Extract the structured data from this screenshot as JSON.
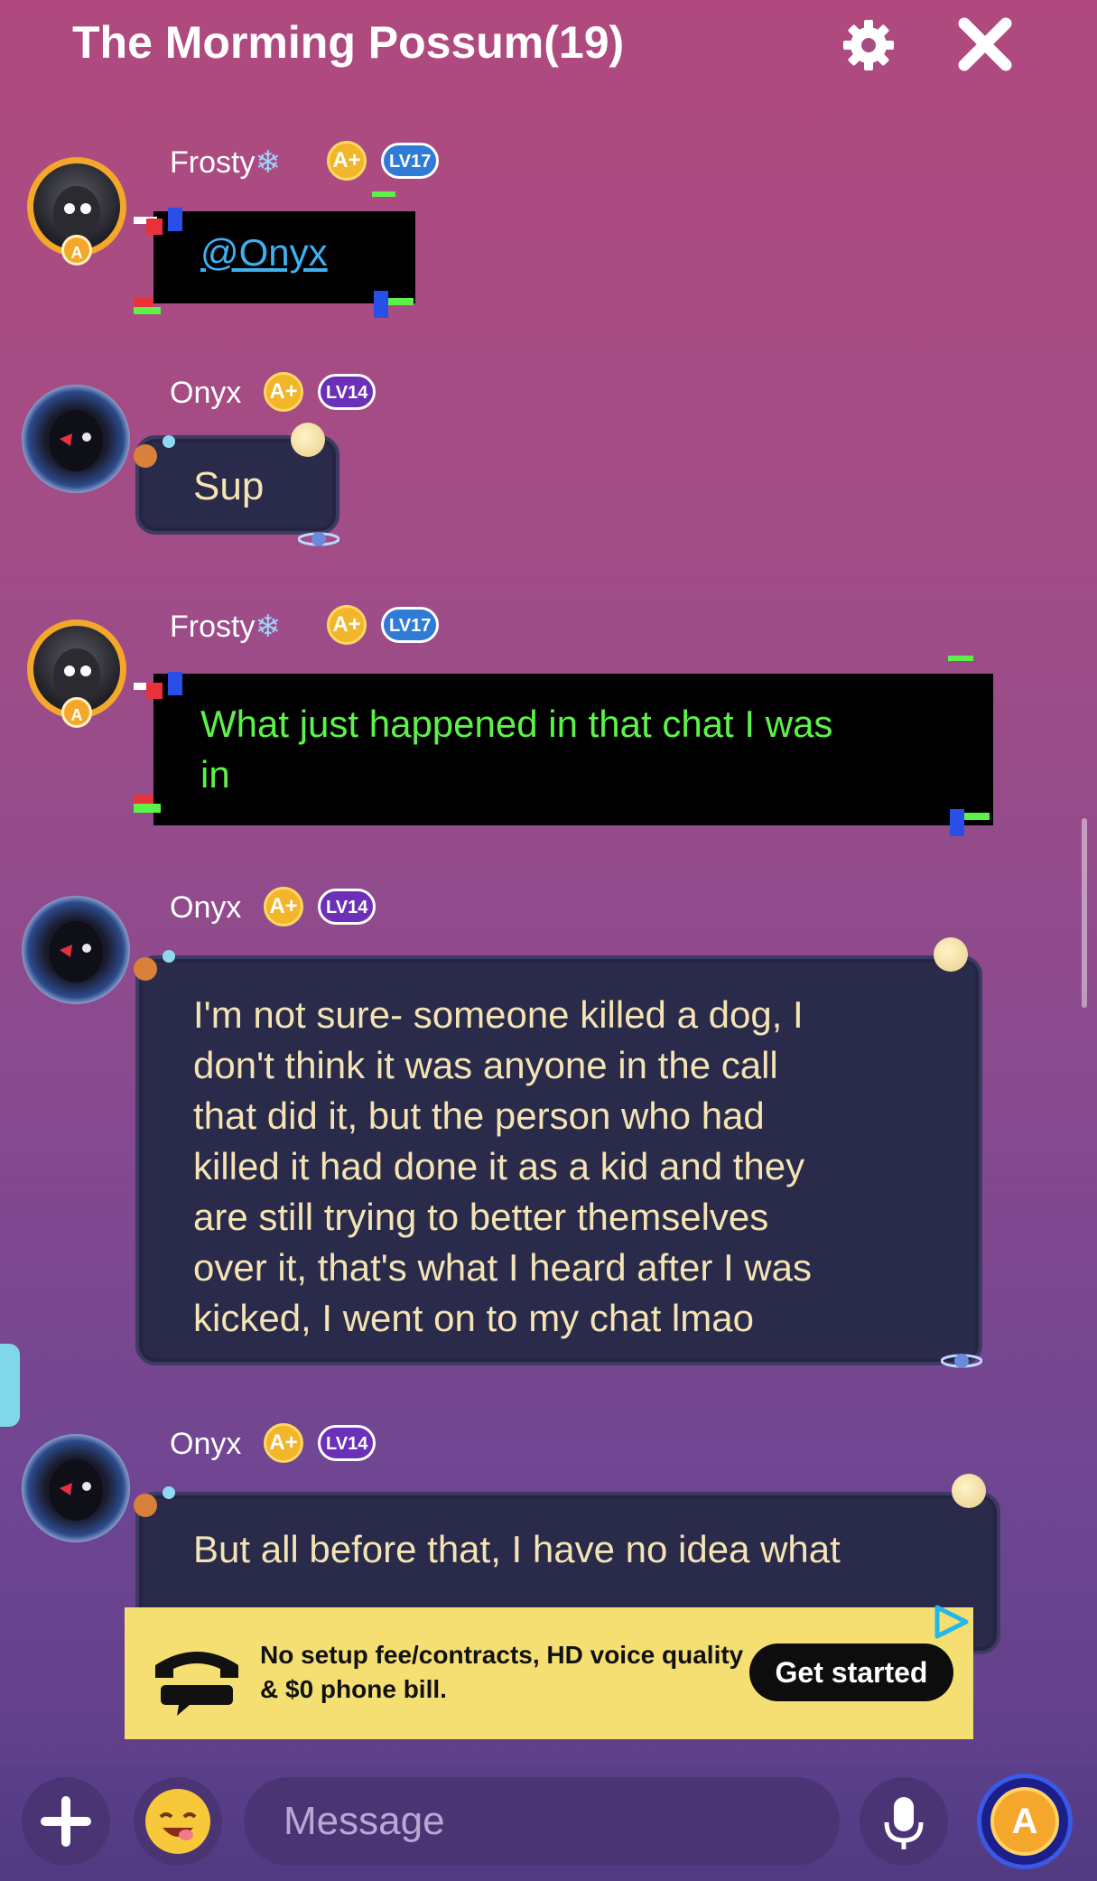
{
  "header": {
    "title": "The Morming Possum(19)",
    "settings_icon": "gear-icon",
    "close_icon": "close-icon"
  },
  "messages": [
    {
      "author": "Frosty",
      "author_suffix": "❄",
      "badge": "A+",
      "level": "LV17",
      "text": "@Onyx",
      "style": "glitch"
    },
    {
      "author": "Onyx",
      "badge": "A+",
      "level": "LV14",
      "text": "Sup",
      "style": "space"
    },
    {
      "author": "Frosty",
      "author_suffix": "❄",
      "badge": "A+",
      "level": "LV17",
      "text": "What just happened in that chat I was\nin",
      "style": "glitch"
    },
    {
      "author": "Onyx",
      "badge": "A+",
      "level": "LV14",
      "text": "I'm not sure- someone killed a dog, I\ndon't think it was anyone in the call\nthat did it, but the person who had\nkilled it had done it as a kid and they\nare still trying to better themselves\nover it, that's what I heard after I was\nkicked, I went on to my chat lmao",
      "style": "space"
    },
    {
      "author": "Onyx",
      "badge": "A+",
      "level": "LV14",
      "text": "But all before that, I have no idea what",
      "style": "space"
    }
  ],
  "ad": {
    "text": "No setup fee/contracts, HD voice quality & $0 phone bill.",
    "cta": "Get started",
    "colors": {
      "background": "#f5df72",
      "button": "#0d0d0d"
    }
  },
  "composer": {
    "placeholder": "Message",
    "add_icon": "plus-icon",
    "emoji_icon": "emoji-icon",
    "mic_icon": "microphone-icon",
    "coin_icon": "amino-coin-icon",
    "coin_label": "A"
  },
  "colors": {
    "glitch_text": "#5df24a",
    "space_text": "#f4e4b4",
    "mention": "#3fb0f0"
  }
}
